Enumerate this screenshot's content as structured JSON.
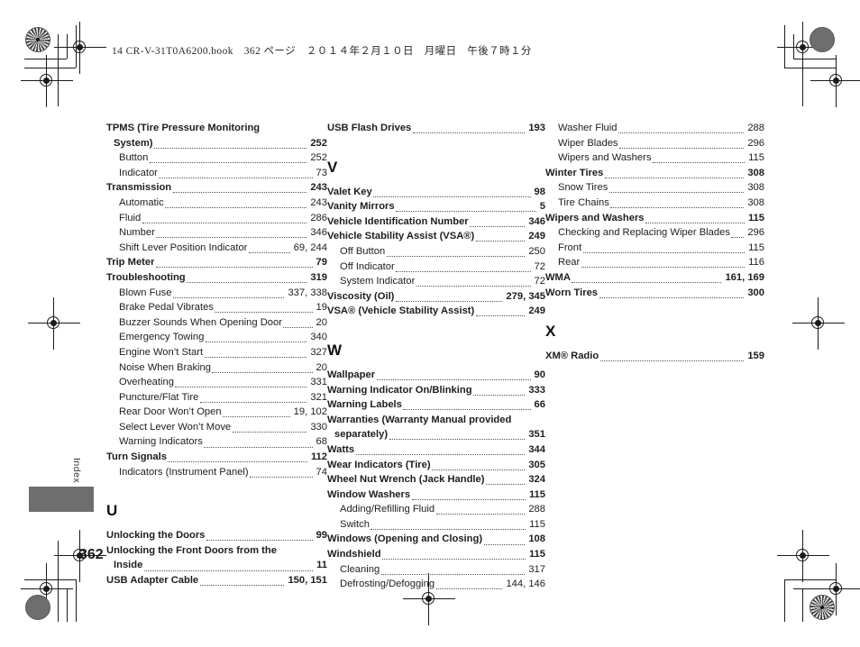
{
  "document": {
    "running_header": "14 CR-V-31T0A6200.book　362 ページ　２０１４年２月１０日　月曜日　午後７時１分",
    "page_number": "362",
    "section_tab": "Index"
  },
  "columns": [
    {
      "id": "column-1",
      "blocks": [
        {
          "type": "entries",
          "entries": [
            {
              "level": 0,
              "name": "TPMS (Tire Pressure Monitoring",
              "page": "",
              "wrap": true
            },
            {
              "level": 0,
              "name": "System)",
              "page": "252",
              "cont": true
            },
            {
              "level": 1,
              "name": "Button",
              "page": "252"
            },
            {
              "level": 1,
              "name": "Indicator",
              "page": "73"
            },
            {
              "level": 0,
              "name": "Transmission",
              "page": "243"
            },
            {
              "level": 1,
              "name": "Automatic",
              "page": "243"
            },
            {
              "level": 1,
              "name": "Fluid",
              "page": "286"
            },
            {
              "level": 1,
              "name": "Number",
              "page": "346"
            },
            {
              "level": 1,
              "name": "Shift Lever Position Indicator",
              "page": "69, 244"
            },
            {
              "level": 0,
              "name": "Trip Meter",
              "page": "79"
            },
            {
              "level": 0,
              "name": "Troubleshooting",
              "page": "319"
            },
            {
              "level": 1,
              "name": "Blown Fuse",
              "page": "337, 338"
            },
            {
              "level": 1,
              "name": "Brake Pedal Vibrates",
              "page": "19"
            },
            {
              "level": 1,
              "name": "Buzzer Sounds When Opening Door",
              "page": "20"
            },
            {
              "level": 1,
              "name": "Emergency Towing",
              "page": "340"
            },
            {
              "level": 1,
              "name": "Engine Won’t Start",
              "page": "327"
            },
            {
              "level": 1,
              "name": "Noise When Braking",
              "page": "20"
            },
            {
              "level": 1,
              "name": "Overheating",
              "page": "331"
            },
            {
              "level": 1,
              "name": "Puncture/Flat Tire",
              "page": "321"
            },
            {
              "level": 1,
              "name": "Rear Door Won’t Open",
              "page": "19, 102"
            },
            {
              "level": 1,
              "name": "Select Lever Won’t Move",
              "page": "330"
            },
            {
              "level": 1,
              "name": "Warning Indicators",
              "page": "68"
            },
            {
              "level": 0,
              "name": "Turn Signals",
              "page": "112"
            },
            {
              "level": 1,
              "name": "Indicators (Instrument Panel)",
              "page": "74"
            }
          ]
        },
        {
          "type": "letter",
          "letter": "U"
        },
        {
          "type": "entries",
          "entries": [
            {
              "level": 0,
              "name": "Unlocking the Doors",
              "page": "99"
            },
            {
              "level": 0,
              "name": "Unlocking the Front Doors from the",
              "page": "",
              "wrap": true
            },
            {
              "level": 0,
              "name": "Inside",
              "page": "11",
              "cont": true
            },
            {
              "level": 0,
              "name": "USB Adapter Cable",
              "page": "150, 151"
            }
          ]
        }
      ]
    },
    {
      "id": "column-2",
      "blocks": [
        {
          "type": "entries",
          "entries": [
            {
              "level": 0,
              "name": "USB Flash Drives",
              "page": "193"
            }
          ]
        },
        {
          "type": "letter",
          "letter": "V"
        },
        {
          "type": "entries",
          "entries": [
            {
              "level": 0,
              "name": "Valet Key",
              "page": "98"
            },
            {
              "level": 0,
              "name": "Vanity Mirrors",
              "page": "5"
            },
            {
              "level": 0,
              "name": "Vehicle Identification Number",
              "page": "346"
            },
            {
              "level": 0,
              "name": "Vehicle Stability Assist (VSA®)",
              "page": "249"
            },
            {
              "level": 1,
              "name": "Off Button",
              "page": "250"
            },
            {
              "level": 1,
              "name": "Off Indicator",
              "page": "72"
            },
            {
              "level": 1,
              "name": "System Indicator",
              "page": "72"
            },
            {
              "level": 0,
              "name": "Viscosity (Oil)",
              "page": "279, 345"
            },
            {
              "level": 0,
              "name": "VSA® (Vehicle Stability Assist)",
              "page": "249"
            }
          ]
        },
        {
          "type": "letter",
          "letter": "W"
        },
        {
          "type": "entries",
          "entries": [
            {
              "level": 0,
              "name": "Wallpaper",
              "page": "90"
            },
            {
              "level": 0,
              "name": "Warning Indicator On/Blinking",
              "page": "333"
            },
            {
              "level": 0,
              "name": "Warning Labels",
              "page": "66"
            },
            {
              "level": 0,
              "name": "Warranties (Warranty Manual provided",
              "page": "",
              "wrap": true
            },
            {
              "level": 0,
              "name": "separately)",
              "page": "351",
              "cont": true
            },
            {
              "level": 0,
              "name": "Watts",
              "page": "344"
            },
            {
              "level": 0,
              "name": "Wear Indicators (Tire)",
              "page": "305"
            },
            {
              "level": 0,
              "name": "Wheel Nut Wrench (Jack Handle)",
              "page": "324"
            },
            {
              "level": 0,
              "name": "Window Washers",
              "page": "115"
            },
            {
              "level": 1,
              "name": "Adding/Refilling Fluid",
              "page": "288"
            },
            {
              "level": 1,
              "name": "Switch",
              "page": "115"
            },
            {
              "level": 0,
              "name": "Windows (Opening and Closing)",
              "page": "108"
            },
            {
              "level": 0,
              "name": "Windshield",
              "page": "115"
            },
            {
              "level": 1,
              "name": "Cleaning",
              "page": "317"
            },
            {
              "level": 1,
              "name": "Defrosting/Defogging",
              "page": "144, 146"
            }
          ]
        }
      ]
    },
    {
      "id": "column-3",
      "blocks": [
        {
          "type": "entries",
          "entries": [
            {
              "level": 1,
              "name": "Washer Fluid",
              "page": "288"
            },
            {
              "level": 1,
              "name": "Wiper Blades",
              "page": "296"
            },
            {
              "level": 1,
              "name": "Wipers and Washers",
              "page": "115"
            },
            {
              "level": 0,
              "name": "Winter Tires",
              "page": "308"
            },
            {
              "level": 1,
              "name": "Snow Tires",
              "page": "308"
            },
            {
              "level": 1,
              "name": "Tire Chains",
              "page": "308"
            },
            {
              "level": 0,
              "name": "Wipers and Washers",
              "page": "115"
            },
            {
              "level": 1,
              "name": "Checking and Replacing Wiper Blades",
              "page": "296"
            },
            {
              "level": 1,
              "name": "Front",
              "page": "115"
            },
            {
              "level": 1,
              "name": "Rear",
              "page": "116"
            },
            {
              "level": 0,
              "name": "WMA",
              "page": "161, 169"
            },
            {
              "level": 0,
              "name": "Worn Tires",
              "page": "300"
            }
          ]
        },
        {
          "type": "letter",
          "letter": "X"
        },
        {
          "type": "entries",
          "entries": [
            {
              "level": 0,
              "name": "XM® Radio",
              "page": "159"
            }
          ]
        }
      ]
    }
  ]
}
